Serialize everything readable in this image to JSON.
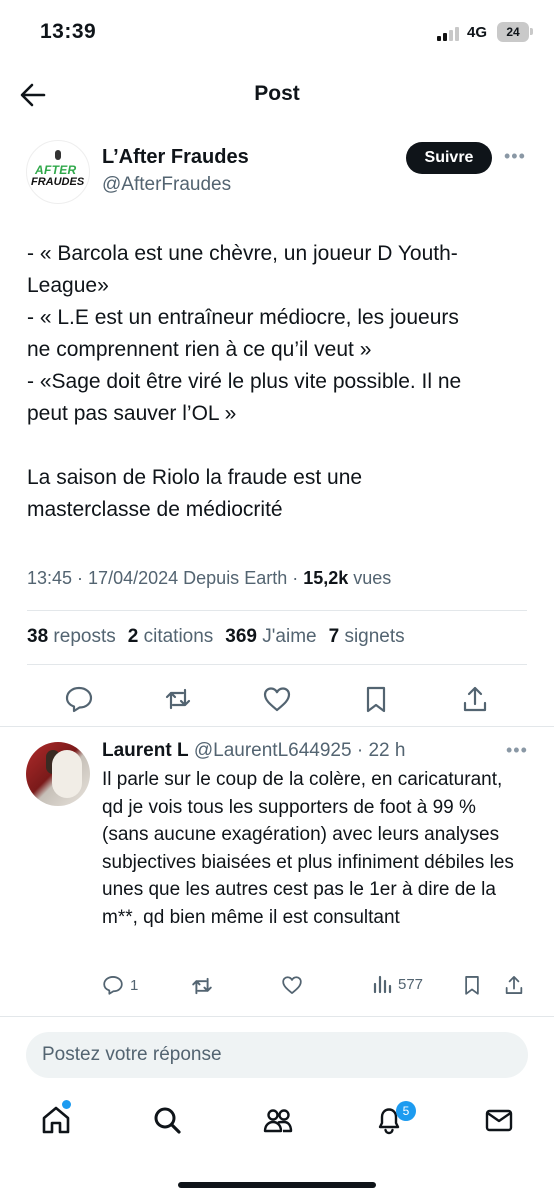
{
  "status_bar": {
    "time": "13:39",
    "network": "4G",
    "battery": "24"
  },
  "header": {
    "title": "Post"
  },
  "author": {
    "name": "L’After Fraudes",
    "handle": "@AfterFraudes",
    "logo_top": "AFTER",
    "logo_bottom": "FRAUDES",
    "follow_label": "Suivre"
  },
  "post": {
    "text": "- « Barcola est une chèvre, un joueur D Youth-\nLeague»\n- « L.E est un entraîneur médiocre, les joueurs\nne comprennent rien à ce qu’il veut »\n- «Sage doit être viré le plus vite possible. Il ne\npeut pas sauver l’OL »\n\nLa saison de Riolo la fraude est une\nmasterclasse de médiocrité",
    "time": "13:45",
    "date": "17/04/2024",
    "source": "Depuis Earth",
    "views_count": "15,2k",
    "views_label": "vues"
  },
  "stats": {
    "reposts_count": "38",
    "reposts_label": "reposts",
    "quotes_count": "2",
    "quotes_label": "citations",
    "likes_count": "369",
    "likes_label": "J'aime",
    "bookmarks_count": "7",
    "bookmarks_label": "signets"
  },
  "reply": {
    "name": "Laurent L",
    "handle": "@LaurentL644925",
    "time": "22 h",
    "text": "Il parle sur le coup de la colère, en caricaturant, qd je vois tous les supporters de foot à 99 % (sans aucune exagération) avec leurs analyses subjectives biaisées et plus infiniment débiles les unes que les autres cest pas le 1er à dire de la m**, qd bien même il est consultant",
    "reply_count": "1",
    "views_count": "577"
  },
  "composer": {
    "placeholder": "Postez votre réponse"
  },
  "tab_bar": {
    "notifications_badge": "5"
  },
  "colors": {
    "accent": "#1d9bf0",
    "text": "#0f1419",
    "muted": "#536471",
    "logo_green": "#2fa84a"
  }
}
